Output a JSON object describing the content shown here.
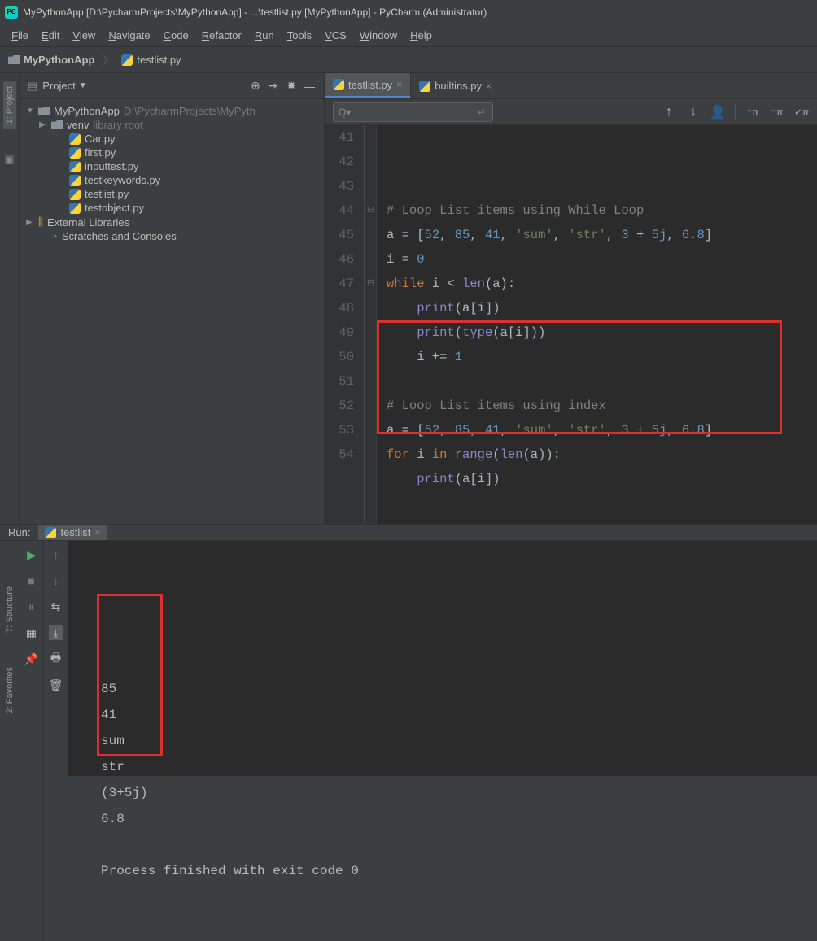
{
  "titlebar": {
    "app_icon_text": "PC",
    "text": "MyPythonApp [D:\\PycharmProjects\\MyPythonApp] - ...\\testlist.py [MyPythonApp] - PyCharm (Administrator)"
  },
  "menu": {
    "items": [
      "File",
      "Edit",
      "View",
      "Navigate",
      "Code",
      "Refactor",
      "Run",
      "Tools",
      "VCS",
      "Window",
      "Help"
    ]
  },
  "breadcrumb": {
    "project": "MyPythonApp",
    "file": "testlist.py"
  },
  "left_gutter": {
    "project_label": "1: Project",
    "structure_label": "7: Structure",
    "favorites_label": "2: Favorites"
  },
  "sidebar": {
    "title": "Project",
    "tree": [
      {
        "level": 0,
        "arrow": "▼",
        "icon": "folder",
        "label": "MyPythonApp",
        "suffix": "D:\\PycharmProjects\\MyPyth"
      },
      {
        "level": 1,
        "arrow": "▶",
        "icon": "folder",
        "label": "venv",
        "suffix": "library root"
      },
      {
        "level": 2,
        "arrow": "",
        "icon": "py",
        "label": "Car.py",
        "suffix": ""
      },
      {
        "level": 2,
        "arrow": "",
        "icon": "py",
        "label": "first.py",
        "suffix": ""
      },
      {
        "level": 2,
        "arrow": "",
        "icon": "py",
        "label": "inputtest.py",
        "suffix": ""
      },
      {
        "level": 2,
        "arrow": "",
        "icon": "py",
        "label": "testkeywords.py",
        "suffix": ""
      },
      {
        "level": 2,
        "arrow": "",
        "icon": "py",
        "label": "testlist.py",
        "suffix": ""
      },
      {
        "level": 2,
        "arrow": "",
        "icon": "py",
        "label": "testobject.py",
        "suffix": ""
      },
      {
        "level": 0,
        "arrow": "▶",
        "icon": "lib",
        "label": "External Libraries",
        "suffix": ""
      },
      {
        "level": 1,
        "arrow": "",
        "icon": "scratch",
        "label": "Scratches and Consoles",
        "suffix": ""
      }
    ]
  },
  "tabs": [
    {
      "label": "testlist.py",
      "active": true
    },
    {
      "label": "builtins.py",
      "active": false
    }
  ],
  "search_placeholder": "Q▾",
  "editor": {
    "lines": [
      {
        "n": 41,
        "fold": "",
        "html": "<span class='c-comment'># Loop List items using While Loop</span>"
      },
      {
        "n": 42,
        "fold": "",
        "html": "a = [<span class='c-num'>52</span>, <span class='c-num'>85</span>, <span class='c-num'>41</span>, <span class='c-str'>'sum'</span>, <span class='c-str'>'str'</span>, <span class='c-num'>3</span> + <span class='c-num'>5j</span>, <span class='c-num'>6.8</span>]"
      },
      {
        "n": 43,
        "fold": "",
        "html": "i = <span class='c-num'>0</span>"
      },
      {
        "n": 44,
        "fold": "⊟",
        "html": "<span class='c-keyword'>while </span>i &lt; <span class='c-builtin'>len</span>(a):"
      },
      {
        "n": 45,
        "fold": "",
        "html": "    <span class='c-builtin'>print</span>(a[i])"
      },
      {
        "n": 46,
        "fold": "",
        "html": "    <span class='c-builtin'>print</span>(<span class='c-builtin'>type</span>(a[i]))"
      },
      {
        "n": 47,
        "fold": "⊟",
        "html": "    i += <span class='c-num'>1</span>"
      },
      {
        "n": 48,
        "fold": "",
        "html": ""
      },
      {
        "n": 49,
        "fold": "",
        "html": "<span class='c-comment'># Loop List items using index</span>"
      },
      {
        "n": 50,
        "fold": "",
        "html": "a = [<span class='c-num'>52</span>, <span class='c-num'>85</span>, <span class='c-num'>41</span>, <span class='c-str'>'sum'</span>, <span class='c-str'>'str'</span>, <span class='c-num'>3</span> + <span class='c-num'>5j</span>, <span class='c-num'>6.8</span>]"
      },
      {
        "n": 51,
        "fold": "",
        "html": "<span class='c-keyword'>for </span>i <span class='c-keyword'>in </span><span class='c-builtin'>range</span>(<span class='c-builtin'>len</span>(a)):"
      },
      {
        "n": 52,
        "fold": "",
        "html": "    <span class='c-builtin'>print</span>(a[i])"
      },
      {
        "n": 53,
        "fold": "",
        "html": ""
      },
      {
        "n": 54,
        "fold": "",
        "html": ""
      }
    ]
  },
  "run": {
    "title": "Run:",
    "tab": "testlist",
    "output": [
      "85",
      "41",
      "sum",
      "str",
      "(3+5j)",
      "6.8",
      "",
      "Process finished with exit code 0"
    ]
  }
}
